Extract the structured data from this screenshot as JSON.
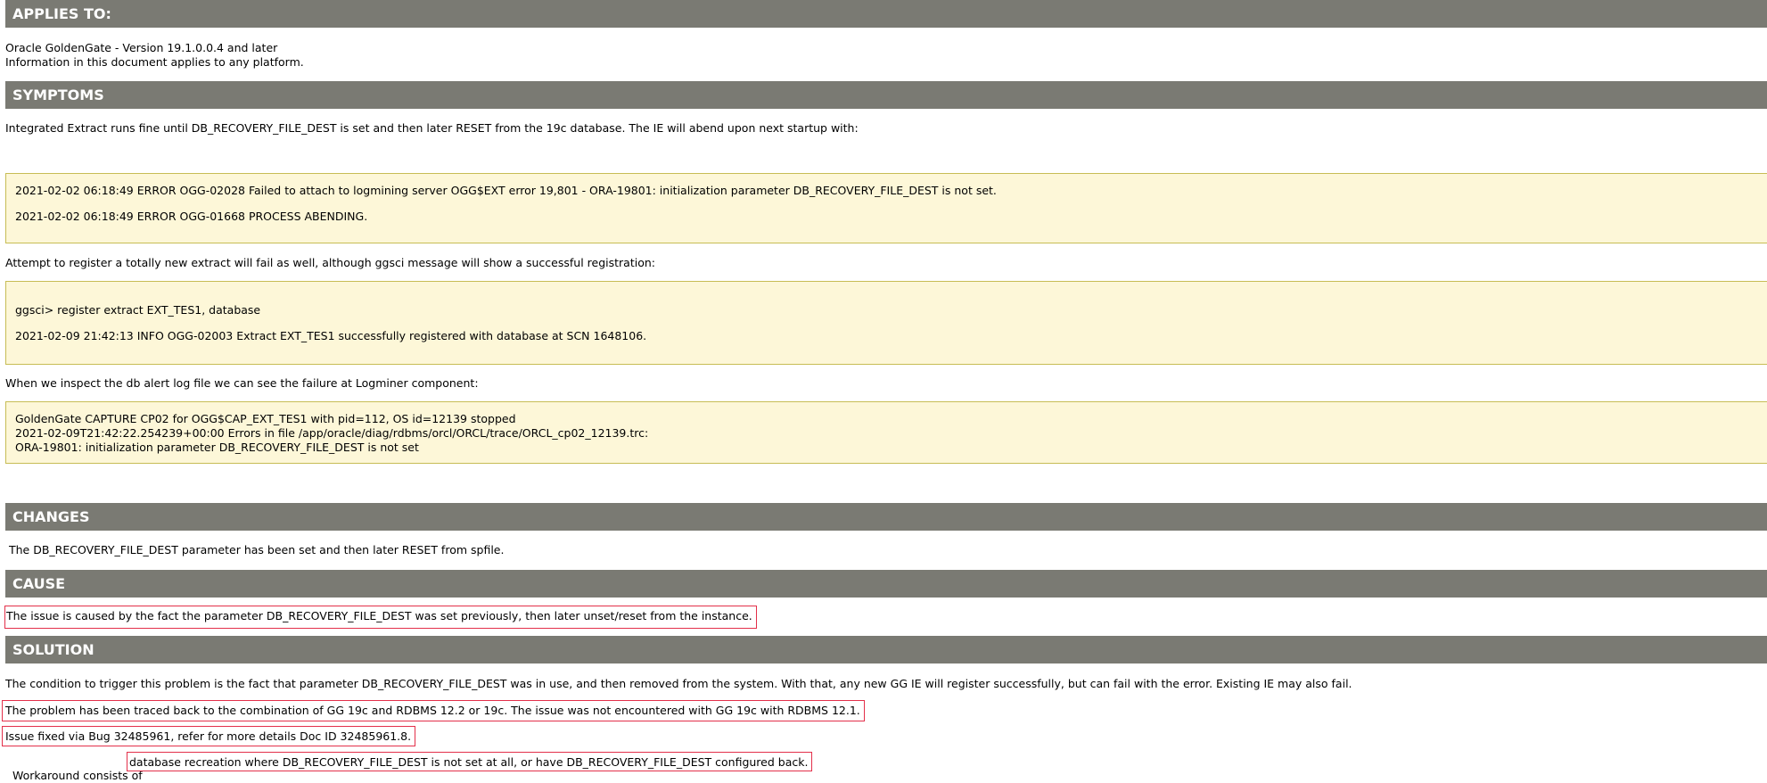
{
  "applies_to": {
    "heading": "APPLIES TO:",
    "lines": [
      "Oracle GoldenGate - Version 19.1.0.0.4 and later",
      "Information in this document applies to any platform."
    ]
  },
  "symptoms": {
    "heading": "SYMPTOMS",
    "intro": "Integrated Extract runs fine until DB_RECOVERY_FILE_DEST is set and then later RESET from the 19c database. The IE will abend upon next startup with:",
    "code1": [
      "2021-02-02 06:18:49 ERROR OGG-02028 Failed to attach to logmining server OGG$EXT error 19,801 - ORA-19801: initialization parameter DB_RECOVERY_FILE_DEST is not set.",
      "2021-02-02 06:18:49 ERROR OGG-01668 PROCESS ABENDING."
    ],
    "register_text": "Attempt to register a totally new extract will fail as well, although ggsci message will show a successful registration:",
    "code2": [
      "ggsci> register extract EXT_TES1, database",
      "2021-02-09 21:42:13 INFO OGG-02003 Extract EXT_TES1 successfully registered with database at SCN 1648106."
    ],
    "alert_text": "When we inspect the db alert log file we can see the failure at Logminer component:",
    "code3": [
      "GoldenGate CAPTURE CP02 for OGG$CAP_EXT_TES1 with pid=112, OS id=12139 stopped",
      "2021-02-09T21:42:22.254239+00:00 Errors in file /app/oracle/diag/rdbms/orcl/ORCL/trace/ORCL_cp02_12139.trc:",
      "ORA-19801: initialization parameter DB_RECOVERY_FILE_DEST is not set"
    ]
  },
  "changes": {
    "heading": "CHANGES",
    "text": " The DB_RECOVERY_FILE_DEST parameter has been set and then later RESET from spfile."
  },
  "cause": {
    "heading": "CAUSE",
    "text": "The issue is caused by the fact the parameter DB_RECOVERY_FILE_DEST was set previously, then later unset/reset from the instance."
  },
  "solution": {
    "heading": "SOLUTION",
    "line1": "The condition to trigger this problem is the fact that parameter DB_RECOVERY_FILE_DEST was in use, and then removed from the system. With that, any new GG IE will register successfully, but can fail with the error. Existing IE may also fail.",
    "line2": "The problem has been traced back to the combination of GG 19c and RDBMS 12.2 or 19c. The issue was not encountered with GG 19c with RDBMS 12.1.",
    "line3": "Issue fixed via Bug 32485961, refer for more details Doc ID 32485961.8.",
    "line4_prefix": "Workaround consists of ",
    "line4_boxed": "database recreation where DB_RECOVERY_FILE_DEST is not set at all, or have DB_RECOVERY_FILE_DEST configured back."
  },
  "colors": {
    "header_bg": "#7a7a73",
    "code_bg": "#fdf7d8",
    "code_border": "#c7bd55",
    "highlight_border": "#e3304a"
  }
}
